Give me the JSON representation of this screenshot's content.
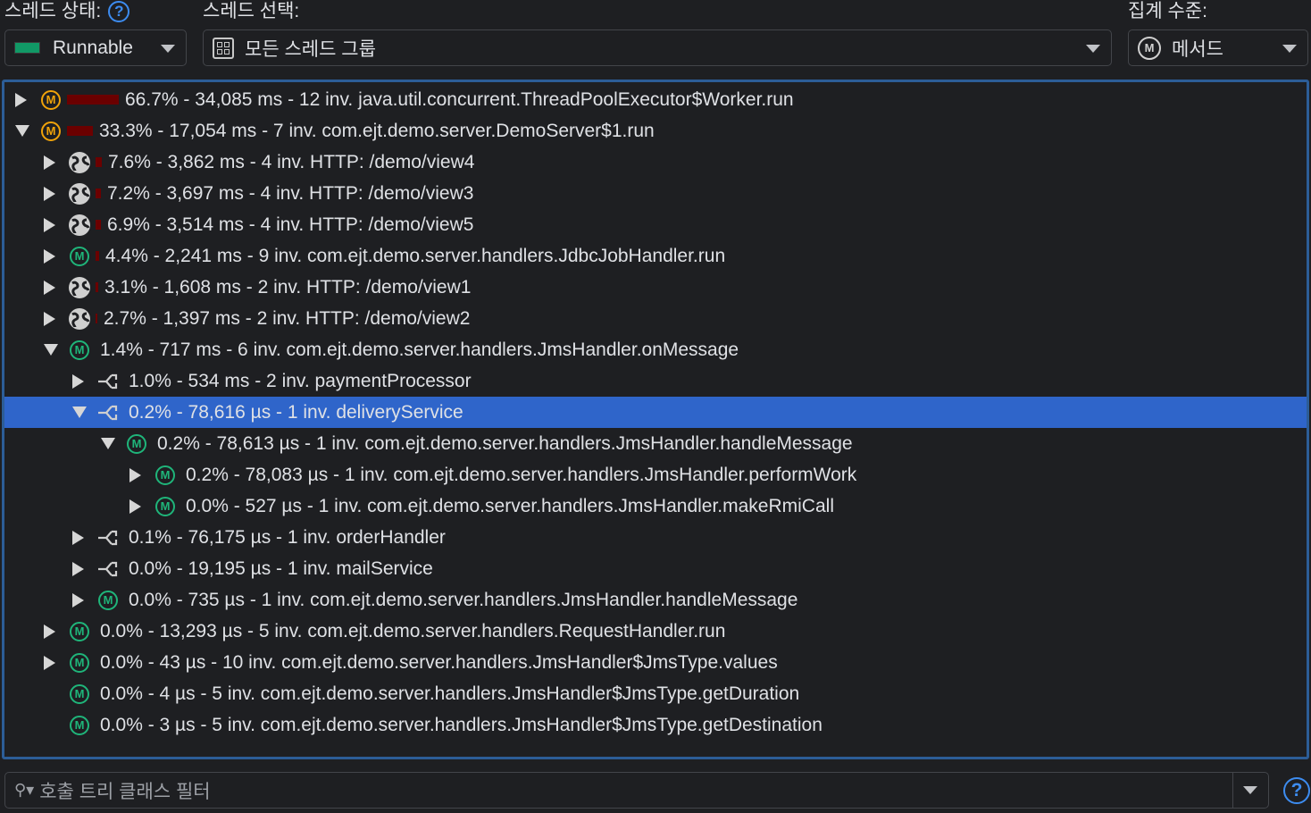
{
  "thread_status": {
    "label": "스레드 상태:",
    "value": "Runnable",
    "color": "#119966"
  },
  "thread_select": {
    "label": "스레드 선택:",
    "value": "모든 스레드 그룹"
  },
  "aggregation": {
    "label": "집계 수준:",
    "value": "메서드"
  },
  "filter": {
    "placeholder": "호출 트리 클래스 필터"
  },
  "colors": {
    "selection": "#2f65ca",
    "method_orange": "#f0a30a",
    "method_green": "#1fb57a",
    "bar": "#6b0000",
    "border": "#2c5d97"
  },
  "tree": [
    {
      "level": 0,
      "state": "collapsed",
      "icon": "method-orange-icon",
      "pct": 66.7,
      "text": "66.7% - 34,085 ms - 12 inv. java.util.concurrent.ThreadPoolExecutor$Worker.run"
    },
    {
      "level": 0,
      "state": "expanded",
      "icon": "method-orange-icon",
      "pct": 33.3,
      "text": "33.3% - 17,054 ms - 7 inv. com.ejt.demo.server.DemoServer$1.run"
    },
    {
      "level": 1,
      "state": "collapsed",
      "icon": "globe-icon",
      "pct": 7.6,
      "text": "7.6% - 3,862 ms - 4 inv. HTTP: /demo/view4"
    },
    {
      "level": 1,
      "state": "collapsed",
      "icon": "globe-icon",
      "pct": 7.2,
      "text": "7.2% - 3,697 ms - 4 inv. HTTP: /demo/view3"
    },
    {
      "level": 1,
      "state": "collapsed",
      "icon": "globe-icon",
      "pct": 6.9,
      "text": "6.9% - 3,514 ms - 4 inv. HTTP: /demo/view5"
    },
    {
      "level": 1,
      "state": "collapsed",
      "icon": "method-green-icon",
      "pct": 4.4,
      "text": "4.4% - 2,241 ms - 9 inv. com.ejt.demo.server.handlers.JdbcJobHandler.run"
    },
    {
      "level": 1,
      "state": "collapsed",
      "icon": "globe-icon",
      "pct": 3.1,
      "text": "3.1% - 1,608 ms - 2 inv. HTTP: /demo/view1"
    },
    {
      "level": 1,
      "state": "collapsed",
      "icon": "globe-icon",
      "pct": 2.7,
      "text": "2.7% - 1,397 ms - 2 inv. HTTP: /demo/view2"
    },
    {
      "level": 1,
      "state": "expanded",
      "icon": "method-green-icon",
      "pct": 1.4,
      "text": "1.4% - 717 ms - 6 inv. com.ejt.demo.server.handlers.JmsHandler.onMessage"
    },
    {
      "level": 2,
      "state": "collapsed",
      "icon": "jms-icon",
      "pct": 1.0,
      "text": "1.0% - 534 ms - 2 inv. paymentProcessor"
    },
    {
      "level": 2,
      "state": "expanded",
      "icon": "jms-icon",
      "pct": 0.2,
      "text": "0.2% - 78,616 µs - 1 inv. deliveryService",
      "selected": true
    },
    {
      "level": 3,
      "state": "expanded",
      "icon": "method-green-icon",
      "pct": 0.2,
      "text": "0.2% - 78,613 µs - 1 inv. com.ejt.demo.server.handlers.JmsHandler.handleMessage"
    },
    {
      "level": 4,
      "state": "collapsed",
      "icon": "method-green-icon",
      "pct": 0.2,
      "text": "0.2% - 78,083 µs - 1 inv. com.ejt.demo.server.handlers.JmsHandler.performWork"
    },
    {
      "level": 4,
      "state": "collapsed",
      "icon": "method-green-icon",
      "pct": 0.0,
      "text": "0.0% - 527 µs - 1 inv. com.ejt.demo.server.handlers.JmsHandler.makeRmiCall"
    },
    {
      "level": 2,
      "state": "collapsed",
      "icon": "jms-icon",
      "pct": 0.1,
      "text": "0.1% - 76,175 µs - 1 inv. orderHandler"
    },
    {
      "level": 2,
      "state": "collapsed",
      "icon": "jms-icon",
      "pct": 0.0,
      "text": "0.0% - 19,195 µs - 1 inv. mailService"
    },
    {
      "level": 2,
      "state": "collapsed",
      "icon": "method-green-icon",
      "pct": 0.0,
      "text": "0.0% - 735 µs - 1 inv. com.ejt.demo.server.handlers.JmsHandler.handleMessage"
    },
    {
      "level": 1,
      "state": "collapsed",
      "icon": "method-green-icon",
      "pct": 0.0,
      "text": "0.0% - 13,293 µs - 5 inv. com.ejt.demo.server.handlers.RequestHandler.run"
    },
    {
      "level": 1,
      "state": "collapsed",
      "icon": "method-green-icon",
      "pct": 0.0,
      "text": "0.0% - 43 µs - 10 inv. com.ejt.demo.server.handlers.JmsHandler$JmsType.values"
    },
    {
      "level": 1,
      "state": "leaf",
      "icon": "method-green-icon",
      "pct": 0.0,
      "text": "0.0% - 4 µs - 5 inv. com.ejt.demo.server.handlers.JmsHandler$JmsType.getDuration"
    },
    {
      "level": 1,
      "state": "leaf",
      "icon": "method-green-icon",
      "pct": 0.0,
      "text": "0.0% - 3 µs - 5 inv. com.ejt.demo.server.handlers.JmsHandler$JmsType.getDestination"
    }
  ]
}
